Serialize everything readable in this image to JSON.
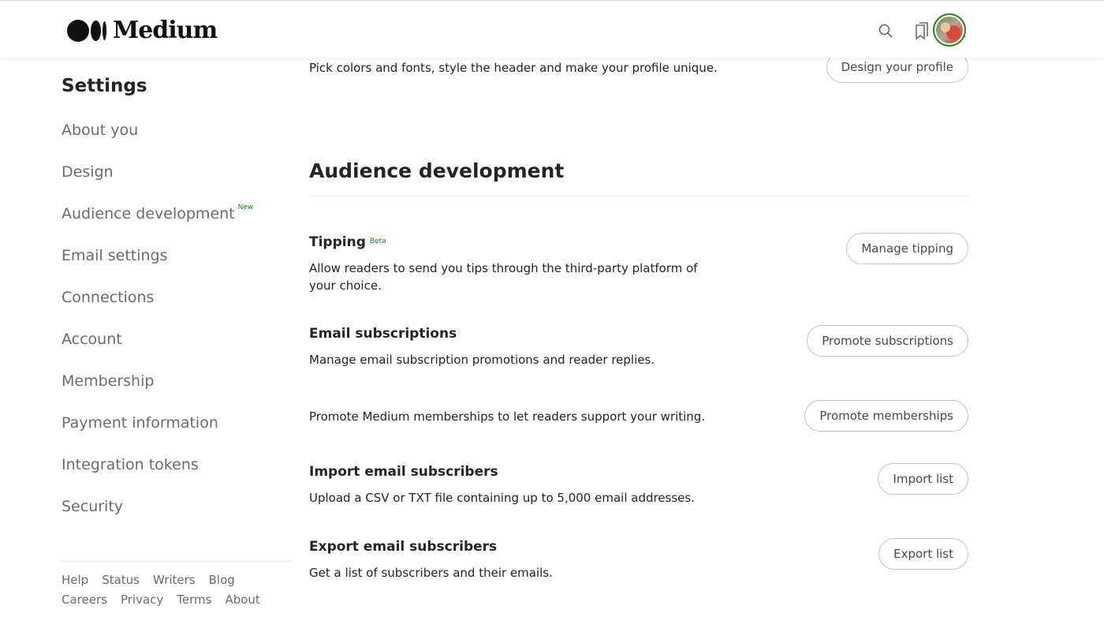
{
  "header": {
    "logo_text": "Medium",
    "icons": [
      "search-icon",
      "bookmarks-icon",
      "notifications-icon"
    ]
  },
  "sidebar": {
    "title": "Settings",
    "items": [
      {
        "label": "About you"
      },
      {
        "label": "Design"
      },
      {
        "label": "Audience development",
        "badge": "New"
      },
      {
        "label": "Email settings"
      },
      {
        "label": "Connections"
      },
      {
        "label": "Account"
      },
      {
        "label": "Membership"
      },
      {
        "label": "Payment information"
      },
      {
        "label": "Integration tokens"
      },
      {
        "label": "Security"
      }
    ],
    "footer_links": [
      "Help",
      "Status",
      "Writers",
      "Blog",
      "Careers",
      "Privacy",
      "Terms",
      "About"
    ]
  },
  "main": {
    "design_row": {
      "description": "Pick colors and fonts, style the header and make your profile unique.",
      "button": "Design your profile"
    },
    "section_title": "Audience development",
    "tipping": {
      "title": "Tipping",
      "badge": "Beta",
      "description": "Allow readers to send you tips through the third-party platform of your choice.",
      "button": "Manage tipping"
    },
    "email_subscriptions": {
      "title": "Email subscriptions",
      "description": "Manage email subscription promotions and reader replies.",
      "button": "Promote subscriptions"
    },
    "memberships": {
      "description": "Promote Medium memberships to let readers support your writing.",
      "button": "Promote memberships"
    },
    "import_subscribers": {
      "title": "Import email subscribers",
      "description": "Upload a CSV or TXT file containing up to 5,000 email addresses.",
      "button": "Import list"
    },
    "export_subscribers": {
      "title": "Export email subscribers",
      "description": "Get a list of subscribers and their emails.",
      "button": "Export list"
    }
  },
  "colors": {
    "accent_green": "#1a8917",
    "text_primary": "#242424",
    "text_secondary": "#6b6b6b"
  }
}
